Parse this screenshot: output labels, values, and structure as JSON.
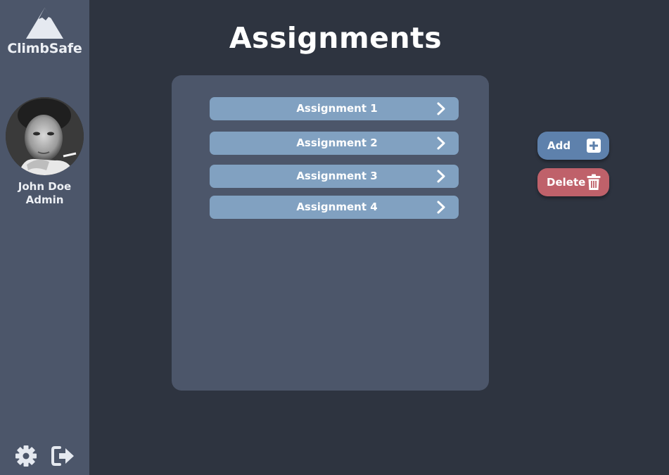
{
  "sidebar": {
    "brand": "ClimbSafe",
    "logo_icon": "mountain-icon",
    "user": {
      "name": "John Doe",
      "role": "Admin"
    },
    "settings_icon": "gear-icon",
    "logout_icon": "logout-icon"
  },
  "main": {
    "title": "Assignments",
    "assignments": [
      {
        "label": "Assignment 1"
      },
      {
        "label": "Assignment 2"
      },
      {
        "label": "Assignment 3"
      },
      {
        "label": "Assignment 4"
      }
    ]
  },
  "actions": {
    "add_label": "Add",
    "add_icon": "plus-square-icon",
    "delete_label": "Delete",
    "delete_icon": "trash-icon"
  },
  "colors": {
    "background": "#2e3440",
    "sidebar": "#4c566a",
    "panel": "#4c566a",
    "item": "#81a1c1",
    "add_button": "#5e81ac",
    "delete_button": "#bf616a"
  }
}
